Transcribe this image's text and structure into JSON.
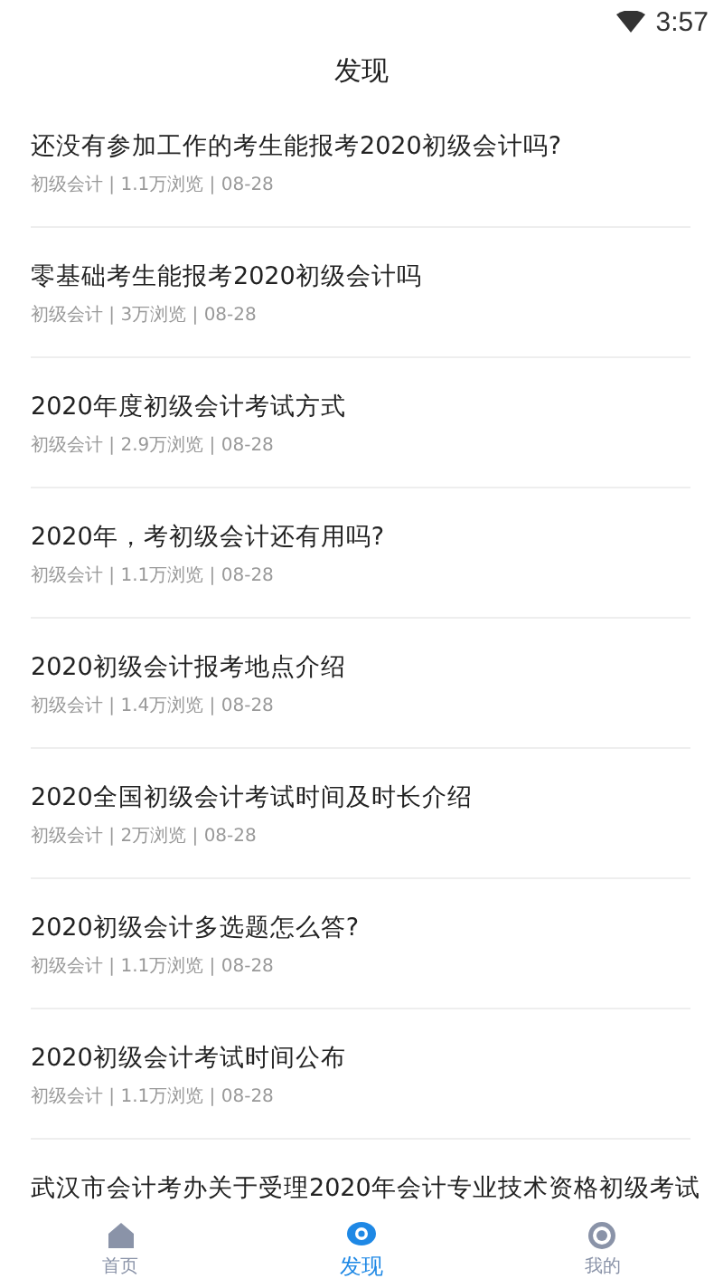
{
  "status_bar": {
    "time": "3:57"
  },
  "header": {
    "title": "发现"
  },
  "articles": [
    {
      "title": "还没有参加工作的考生能报考2020初级会计吗?",
      "meta": "初级会计 | 1.1万浏览 | 08-28"
    },
    {
      "title": "零基础考生能报考2020初级会计吗",
      "meta": "初级会计 | 3万浏览 | 08-28"
    },
    {
      "title": "2020年度初级会计考试方式",
      "meta": "初级会计 | 2.9万浏览 | 08-28"
    },
    {
      "title": "2020年，考初级会计还有用吗?",
      "meta": "初级会计 | 1.1万浏览 | 08-28"
    },
    {
      "title": "2020初级会计报考地点介绍",
      "meta": "初级会计 | 1.4万浏览 | 08-28"
    },
    {
      "title": "2020全国初级会计考试时间及时长介绍",
      "meta": "初级会计 | 2万浏览 | 08-28"
    },
    {
      "title": "2020初级会计多选题怎么答?",
      "meta": "初级会计 | 1.1万浏览 | 08-28"
    },
    {
      "title": "2020初级会计考试时间公布",
      "meta": "初级会计 | 1.1万浏览 | 08-28"
    },
    {
      "title": "武汉市会计考办关于受理2020年会计专业技术资格初级考试"
    }
  ],
  "tab_bar": [
    {
      "label": "首页",
      "kind": "home",
      "selected": false
    },
    {
      "label": "发现",
      "kind": "discover",
      "selected": true
    },
    {
      "label": "我的",
      "kind": "profile",
      "selected": false
    }
  ]
}
